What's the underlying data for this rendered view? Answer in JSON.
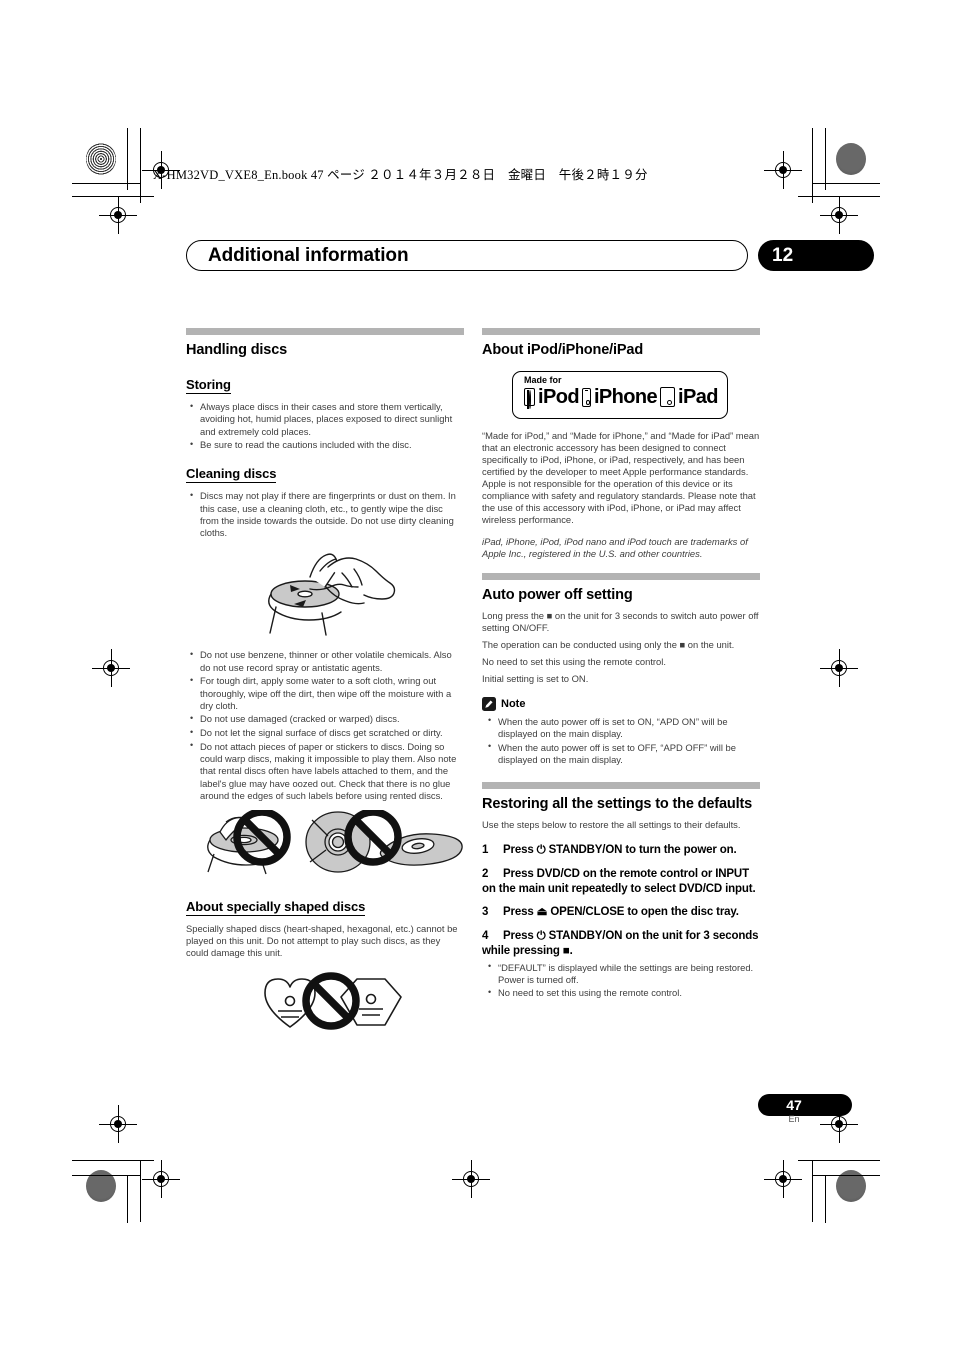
{
  "print": {
    "book_line": "X-HM32VD_VXE8_En.book   47 ページ   ２０１４年３月２８日　金曜日　午後２時１９分"
  },
  "chapter": {
    "title": "Additional information",
    "number": "12"
  },
  "left_column": {
    "handling": {
      "heading": "Handling discs",
      "storing": {
        "heading": "Storing",
        "bullets": [
          "Always place discs in their cases and store them vertically, avoiding hot, humid places, places exposed to direct sunlight and extremely cold places.",
          "Be sure to read the cautions included with the disc."
        ]
      },
      "cleaning": {
        "heading": "Cleaning discs",
        "bullets_before_figure": [
          "Discs may not play if there are fingerprints or dust on them. In this case, use a cleaning cloth, etc., to gently wipe the disc from the inside towards the outside. Do not use dirty cleaning cloths."
        ],
        "figure_name": "wiping-disc-with-cloth-illustration",
        "bullets_after_figure": [
          "Do not use benzene, thinner or other volatile chemicals. Also do not use record spray or antistatic agents.",
          "For tough dirt, apply some water to a soft cloth, wring out thoroughly, wipe off the dirt, then wipe off the moisture with a dry cloth.",
          "Do not use damaged (cracked or warped) discs.",
          "Do not let the signal surface of discs get scratched or dirty.",
          "Do not attach pieces of paper or stickers to discs. Doing so could warp discs, making it impossible to play them. Also note that rental discs often have labels attached to them, and the label's glue may have oozed out. Check that there is no glue around the edges of such labels before using rented discs."
        ],
        "figure2_name": "prohibited-damaged-discs-illustration"
      }
    },
    "shaped": {
      "heading": "About specially shaped discs",
      "body": "Specially shaped discs (heart-shaped, hexagonal, etc.) cannot be played on this unit. Do not attempt to play such discs, as they could damage this unit.",
      "figure_name": "prohibited-shaped-discs-illustration"
    }
  },
  "right_column": {
    "ipod": {
      "heading": "About iPod/iPhone/iPad",
      "badge": {
        "label": "Made for",
        "ipod": "iPod",
        "iphone": "iPhone",
        "ipad": "iPad"
      },
      "paragraph": "“Made for iPod,” and “Made for iPhone,” and “Made for iPad” mean that an electronic accessory has been designed to connect specifically to iPod, iPhone, or iPad, respectively, and has been certified by the developer to meet Apple performance standards. Apple is not responsible for the operation of this device or its compliance with safety and regulatory standards. Please note that the use of this accessory with iPod, iPhone, or iPad may affect wireless performance.",
      "trademark": "iPad, iPhone, iPod, iPod nano and iPod touch are trademarks of Apple Inc., registered in the U.S. and other countries."
    },
    "auto_power": {
      "heading": "Auto power off setting",
      "lines": [
        "Long press the ■ on the unit for 3 seconds to switch auto power off setting ON/OFF.",
        "The operation can be conducted using only the ■ on the unit.",
        "No need to set this using the remote control.",
        "Initial setting is set to ON."
      ],
      "note_label": "Note",
      "note_bullets": [
        "When the auto power off is set to ON, “APD ON” will be displayed on the main display.",
        "When the auto power off is set to OFF, “APD OFF” will be displayed on the main display."
      ]
    },
    "restoring": {
      "heading": "Restoring all the settings to the defaults",
      "intro": "Use the steps below to restore the all settings to their defaults.",
      "steps": [
        {
          "num": "1",
          "text": "Press ⏻ STANDBY/ON to turn the power on."
        },
        {
          "num": "2",
          "text": "Press DVD/CD on the remote control or INPUT on the main unit repeatedly to select DVD/CD input."
        },
        {
          "num": "3",
          "text": "Press ⏏ OPEN/CLOSE to open the disc tray."
        },
        {
          "num": "4",
          "text": "Press ⏻ STANDBY/ON on the unit for 3 seconds while pressing ■."
        }
      ],
      "step_bullets": [
        "“DEFAULT” is displayed while the settings are being restored. Power is turned off.",
        "No need to set this using the remote control."
      ]
    }
  },
  "footer": {
    "page_number": "47",
    "language": "En"
  }
}
